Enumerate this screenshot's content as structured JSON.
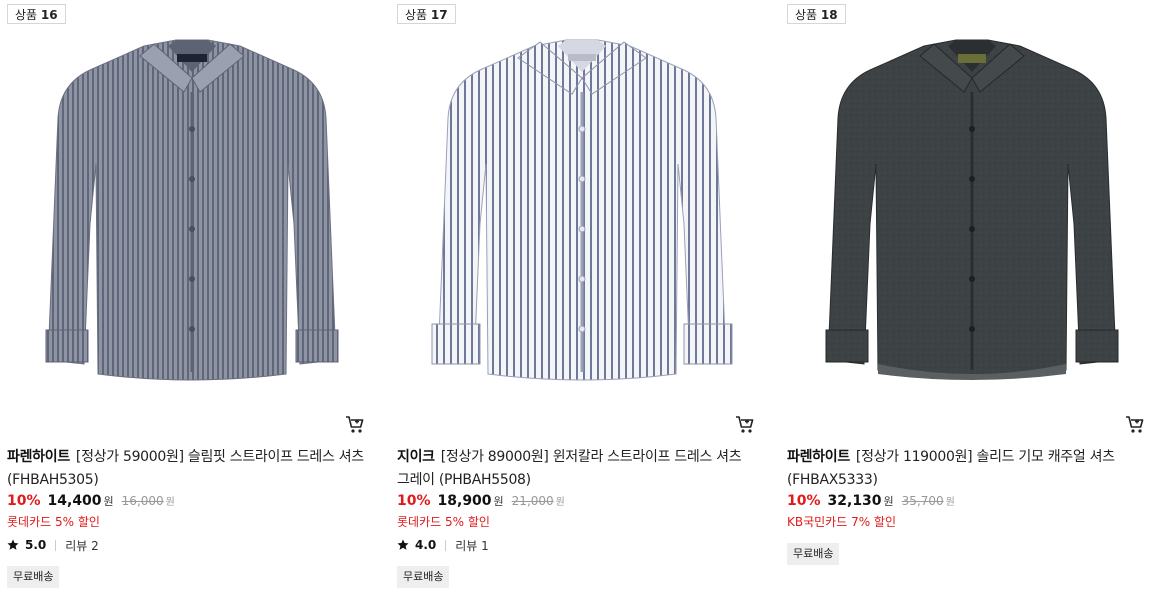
{
  "colors": {
    "discount": "#e11b1b",
    "badge_border": "#d6d6d6",
    "shipping_bg": "#eeeeee",
    "strikethrough": "#999999"
  },
  "products": [
    {
      "badge_prefix": "상품",
      "badge_num": "16",
      "image_icon": "gray-striped-shirt-image",
      "brand": "파렌하이트",
      "name": "[정상가 59000원] 슬림핏 스트라이프 드레스 셔츠 (FHBAH5305)",
      "discount_rate": "10%",
      "sale_price": "14,400",
      "sale_unit": "원",
      "original_price": "16,000",
      "original_unit": "원",
      "card_benefit": "롯데카드 5% 할인",
      "rating": "5.0",
      "review": "리뷰 2",
      "shipping": "무료배송",
      "cart_icon": "cart-icon"
    },
    {
      "badge_prefix": "상품",
      "badge_num": "17",
      "image_icon": "white-striped-shirt-image",
      "brand": "지이크",
      "name": "[정상가 89000원] 윈저칼라 스트라이프 드레스 셔츠 그레이 (PHBAH5508)",
      "discount_rate": "10%",
      "sale_price": "18,900",
      "sale_unit": "원",
      "original_price": "21,000",
      "original_unit": "원",
      "card_benefit": "롯데카드 5% 할인",
      "rating": "4.0",
      "review": "리뷰 1",
      "shipping": "무료배송",
      "cart_icon": "cart-icon"
    },
    {
      "badge_prefix": "상품",
      "badge_num": "18",
      "image_icon": "charcoal-solid-shirt-image",
      "brand": "파렌하이트",
      "name": "[정상가 119000원] 솔리드 기모 캐주얼 셔츠 (FHBAX5333)",
      "discount_rate": "10%",
      "sale_price": "32,130",
      "sale_unit": "원",
      "original_price": "35,700",
      "original_unit": "원",
      "card_benefit": "KB국민카드 7% 할인",
      "shipping": "무료배송",
      "cart_icon": "cart-icon"
    }
  ]
}
